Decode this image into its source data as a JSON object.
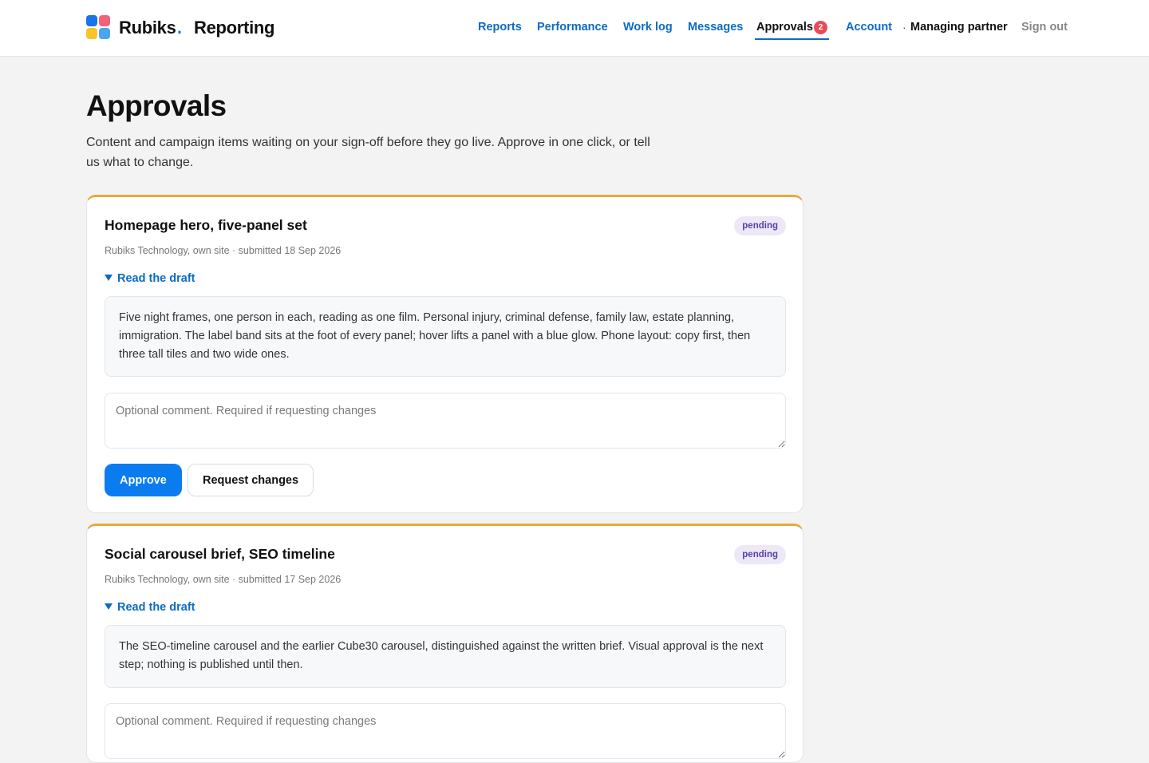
{
  "app": {
    "brand": "Rubiks",
    "brand_dot": ".",
    "brand_sub": "Reporting",
    "colors": {
      "accent": "#0a7cf0",
      "link": "#0c6bc4",
      "pending_border": "#e7a83b",
      "badge": "#e74c5a"
    }
  },
  "nav": {
    "items": [
      {
        "label": "Reports"
      },
      {
        "label": "Performance"
      },
      {
        "label": "Work log"
      },
      {
        "label": "Messages"
      },
      {
        "label": "Approvals",
        "active": true,
        "badge": "2"
      },
      {
        "label": "Account"
      }
    ],
    "separator": "·",
    "role": "Managing partner",
    "sign_out": "Sign out"
  },
  "page": {
    "title": "Approvals",
    "description": "Content and campaign items waiting on your sign-off before they go live. Approve in one click, or tell us what to change."
  },
  "approvals": [
    {
      "title": "Homepage hero, five-panel set",
      "status": "pending",
      "meta": "Rubiks Technology, own site · submitted 18 Sep 2026",
      "toggle_label": "Read the draft",
      "draft": "Five night frames, one person in each, reading as one film. Personal injury, criminal defense, family law, estate planning, immigration. The label band sits at the foot of every panel; hover lifts a panel with a blue glow. Phone layout: copy first, then three tall tiles and two wide ones.",
      "comment_placeholder": "Optional comment. Required if requesting changes",
      "approve_label": "Approve",
      "request_label": "Request changes"
    },
    {
      "title": "Social carousel brief, SEO timeline",
      "status": "pending",
      "meta": "Rubiks Technology, own site · submitted 17 Sep 2026",
      "toggle_label": "Read the draft",
      "draft": "The SEO-timeline carousel and the earlier Cube30 carousel, distinguished against the written brief. Visual approval is the next step; nothing is published until then.",
      "comment_placeholder": "Optional comment. Required if requesting changes"
    }
  ]
}
